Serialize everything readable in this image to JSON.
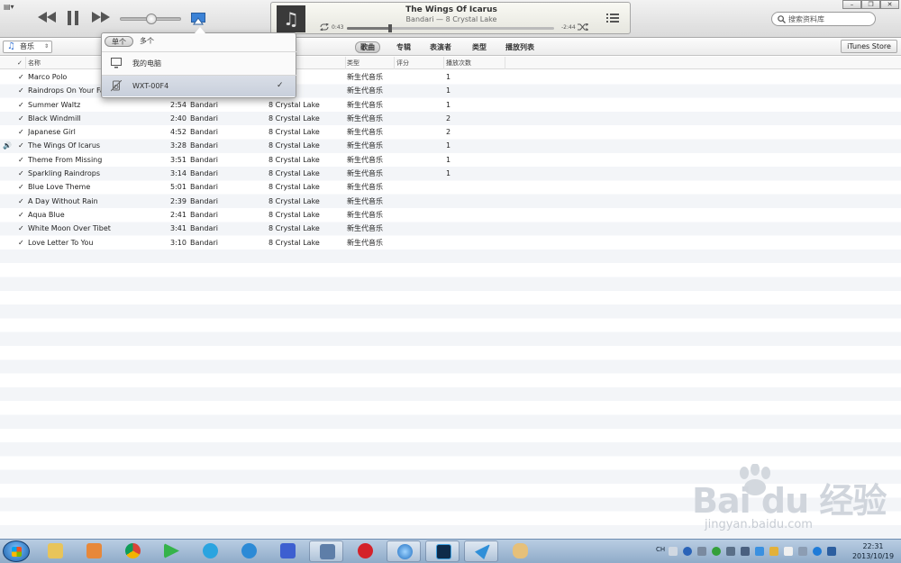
{
  "window": {
    "menu_label": "▤▾",
    "minimize_label": "–",
    "restore_label": "❐",
    "close_label": "✕"
  },
  "player": {
    "title": "The Wings Of Icarus",
    "subtitle": "Bandari — 8 Crystal Lake",
    "elapsed": "0:43",
    "remaining": "-2:44",
    "progress_fraction": 0.21,
    "volume_fraction": 0.5
  },
  "search": {
    "placeholder": "搜索资料库"
  },
  "nav": {
    "library": "音乐",
    "tabs": [
      {
        "label": "歌曲",
        "active": true
      },
      {
        "label": "专辑",
        "active": false
      },
      {
        "label": "表演者",
        "active": false
      },
      {
        "label": "类型",
        "active": false
      },
      {
        "label": "播放列表",
        "active": false
      }
    ],
    "store": "iTunes Store"
  },
  "table": {
    "headers": {
      "check": "✓",
      "name": "名称",
      "genre": "类型",
      "rating": "评分",
      "plays": "播放次数"
    },
    "rows": [
      {
        "playing": "",
        "check": "✓",
        "name": "Marco Polo",
        "time": "",
        "artist": "",
        "album": "",
        "genre": "新生代音乐",
        "plays": "1"
      },
      {
        "playing": "",
        "check": "✓",
        "name": "Raindrops On Your Face",
        "time": "",
        "artist": "",
        "album": "Lake",
        "genre": "新生代音乐",
        "plays": "1"
      },
      {
        "playing": "",
        "check": "✓",
        "name": "Summer Waltz",
        "time": "2:54",
        "artist": "Bandari",
        "album": "8 Crystal Lake",
        "genre": "新生代音乐",
        "plays": "1"
      },
      {
        "playing": "",
        "check": "✓",
        "name": "Black Windmill",
        "time": "2:40",
        "artist": "Bandari",
        "album": "8 Crystal Lake",
        "genre": "新生代音乐",
        "plays": "2"
      },
      {
        "playing": "",
        "check": "✓",
        "name": "Japanese Girl",
        "time": "4:52",
        "artist": "Bandari",
        "album": "8 Crystal Lake",
        "genre": "新生代音乐",
        "plays": "2"
      },
      {
        "playing": "🔊",
        "check": "✓",
        "name": "The Wings Of Icarus",
        "time": "3:28",
        "artist": "Bandari",
        "album": "8 Crystal Lake",
        "genre": "新生代音乐",
        "plays": "1"
      },
      {
        "playing": "",
        "check": "✓",
        "name": "Theme From Missing",
        "time": "3:51",
        "artist": "Bandari",
        "album": "8 Crystal Lake",
        "genre": "新生代音乐",
        "plays": "1"
      },
      {
        "playing": "",
        "check": "✓",
        "name": "Sparkling Raindrops",
        "time": "3:14",
        "artist": "Bandari",
        "album": "8 Crystal Lake",
        "genre": "新生代音乐",
        "plays": "1"
      },
      {
        "playing": "",
        "check": "✓",
        "name": "Blue Love Theme",
        "time": "5:01",
        "artist": "Bandari",
        "album": "8 Crystal Lake",
        "genre": "新生代音乐",
        "plays": ""
      },
      {
        "playing": "",
        "check": "✓",
        "name": "A Day Without Rain",
        "time": "2:39",
        "artist": "Bandari",
        "album": "8 Crystal Lake",
        "genre": "新生代音乐",
        "plays": ""
      },
      {
        "playing": "",
        "check": "✓",
        "name": "Aqua Blue",
        "time": "2:41",
        "artist": "Bandari",
        "album": "8 Crystal Lake",
        "genre": "新生代音乐",
        "plays": ""
      },
      {
        "playing": "",
        "check": "✓",
        "name": "White Moon Over Tibet",
        "time": "3:41",
        "artist": "Bandari",
        "album": "8 Crystal Lake",
        "genre": "新生代音乐",
        "plays": ""
      },
      {
        "playing": "",
        "check": "✓",
        "name": "Love Letter To You",
        "time": "3:10",
        "artist": "Bandari",
        "album": "8 Crystal Lake",
        "genre": "新生代音乐",
        "plays": ""
      }
    ]
  },
  "airplay_popover": {
    "seg_single": "单个",
    "seg_multiple": "多个",
    "devices": [
      {
        "label": "我的电脑",
        "selected": false,
        "check": ""
      },
      {
        "label": "WXT-00F4",
        "selected": true,
        "check": "✓"
      }
    ]
  },
  "watermark": {
    "logo": "Bai du 经验",
    "url": "jingyan.baidu.com"
  },
  "taskbar": {
    "tray_lang": "CH",
    "time": "22:31",
    "date": "2013/10/19"
  },
  "colors": {
    "accent": "#2f6fd3",
    "taskbar": "#a6bfda"
  }
}
